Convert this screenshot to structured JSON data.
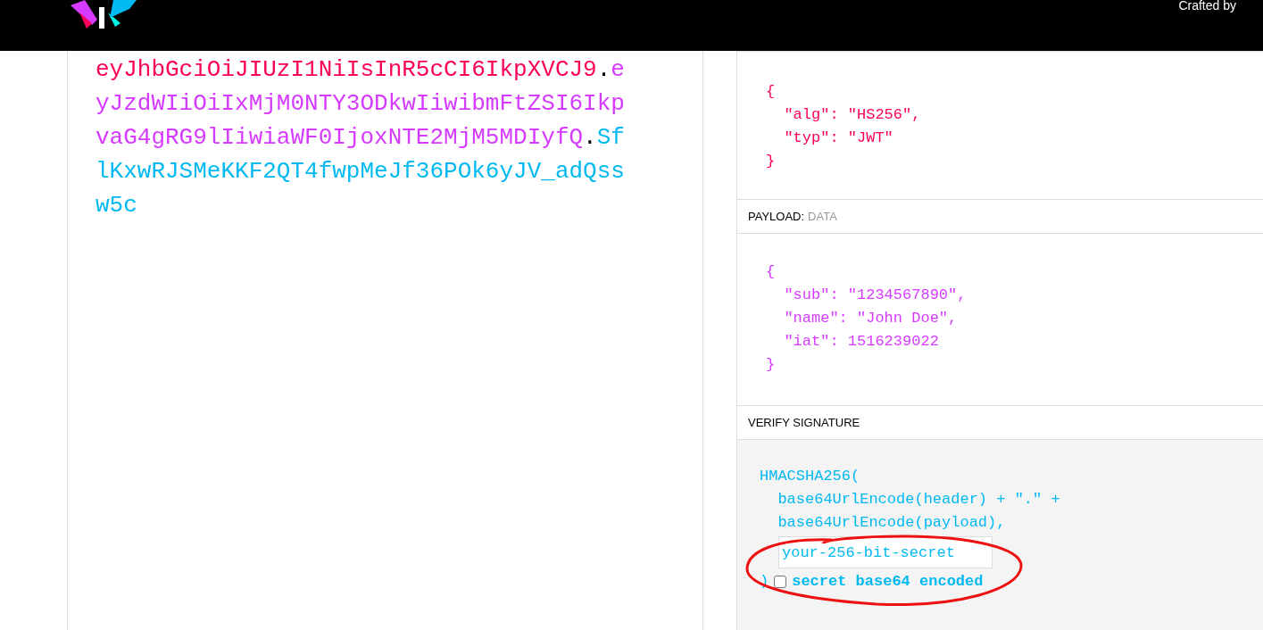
{
  "top_bar": {
    "credit": "Crafted by"
  },
  "encoded": {
    "header": "eyJhbGciOiJIUzI1NiIsInR5cCI6IkpXVCJ9",
    "payload": "eyJzdWIiOiIxMjM0NTY3ODkwIiwibmFtZSI6IkpvaG4gRG9lIiwiaWF0IjoxNTE2MjM5MDIyfQ",
    "signature": "SflKxwRJSMeKKF2QT4fwpMeJf36POk6yJV_adQssw5c",
    "separator": "."
  },
  "decoded_header": {
    "lines": [
      "{",
      "  \"alg\": \"HS256\",",
      "  \"typ\": \"JWT\"",
      "}"
    ]
  },
  "payload_section": {
    "title": "PAYLOAD:",
    "subtitle": "DATA",
    "lines": [
      "{",
      "  \"sub\": \"1234567890\",",
      "  \"name\": \"John Doe\",",
      "  \"iat\": 1516239022",
      "}"
    ]
  },
  "verify_section": {
    "title": "VERIFY SIGNATURE",
    "lines": [
      "HMACSHA256(",
      "  base64UrlEncode(header) + \".\" +",
      "  base64UrlEncode(payload),"
    ],
    "secret": "your-256-bit-secret",
    "close": ")",
    "base64_checkbox": {
      "label": "secret base64 encoded",
      "checked": false
    }
  }
}
